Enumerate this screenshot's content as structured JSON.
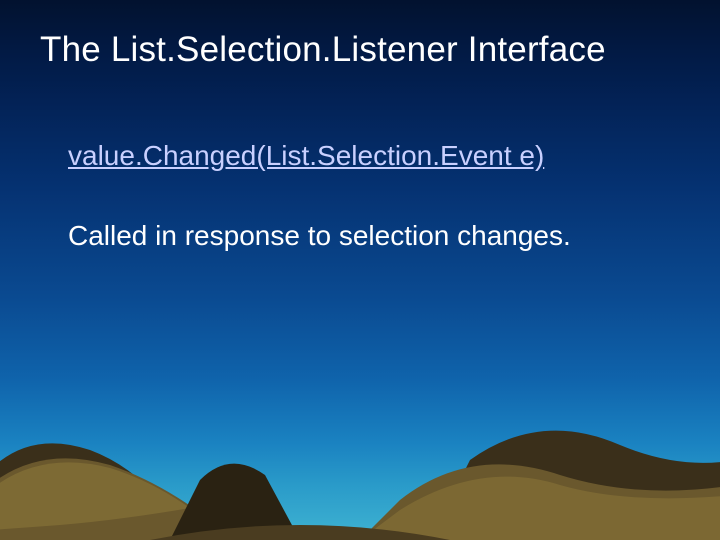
{
  "title": "The List.Selection.Listener Interface",
  "link_text": "value.Changed(List.Selection.Event e)",
  "description": "Called in response to selection changes."
}
